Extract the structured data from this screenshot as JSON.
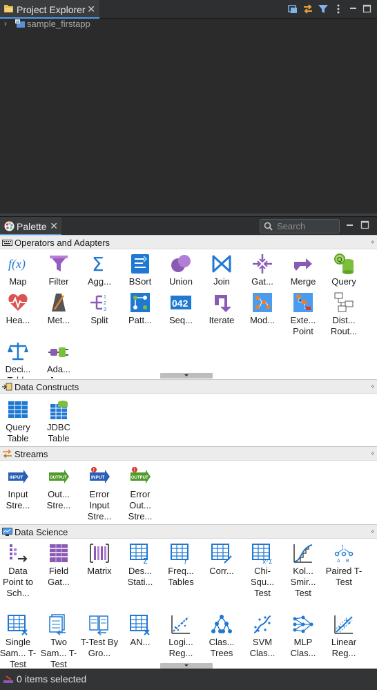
{
  "project_explorer": {
    "title": "Project Explorer",
    "tree": [
      {
        "label": "sample_firstapp",
        "expanded": false
      }
    ]
  },
  "palette": {
    "title": "Palette",
    "search_placeholder": "Search",
    "drawers": [
      {
        "title": "Operators and Adapters",
        "items": [
          {
            "label": "Map",
            "icon": "map-fx-icon"
          },
          {
            "label": "Filter",
            "icon": "funnel-icon"
          },
          {
            "label": "Agg...",
            "icon": "sigma-icon"
          },
          {
            "label": "BSort",
            "icon": "sort-icon"
          },
          {
            "label": "Union",
            "icon": "union-icon"
          },
          {
            "label": "Join",
            "icon": "bowtie-join-icon"
          },
          {
            "label": "Gat...",
            "icon": "gather-icon"
          },
          {
            "label": "Merge",
            "icon": "merge-arrow-icon"
          },
          {
            "label": "Query",
            "icon": "query-db-icon"
          },
          {
            "label": "Hea...",
            "icon": "heartbeat-icon"
          },
          {
            "label": "Met...",
            "icon": "metronome-icon"
          },
          {
            "label": "Split",
            "icon": "split-icon"
          },
          {
            "label": "Patt...",
            "icon": "pattern-icon"
          },
          {
            "label": "Seq...",
            "icon": "sequence-icon"
          },
          {
            "label": "Iterate",
            "icon": "iterate-icon"
          },
          {
            "label": "Mod...",
            "icon": "module-icon"
          },
          {
            "label": "Exte... Point",
            "icon": "extension-point-icon"
          },
          {
            "label": "Dist... Rout...",
            "icon": "distributed-router-icon"
          },
          {
            "label": "Deci... Table",
            "icon": "decision-scales-icon"
          },
          {
            "label": "Ada... Java",
            "icon": "java-adapter-plug-icon"
          }
        ]
      },
      {
        "title": "Data Constructs",
        "items": [
          {
            "label": "Query Table",
            "icon": "query-table-icon"
          },
          {
            "label": "JDBC Table",
            "icon": "jdbc-table-icon"
          }
        ]
      },
      {
        "title": "Streams",
        "items": [
          {
            "label": "Input Stre...",
            "icon": "input-stream-icon",
            "tag": "INPUT"
          },
          {
            "label": "Out... Stre...",
            "icon": "output-stream-icon",
            "tag": "OUTPUT"
          },
          {
            "label": "Error Input Stre...",
            "icon": "error-input-stream-icon",
            "tag": "INPUT"
          },
          {
            "label": "Error Out... Stre...",
            "icon": "error-output-stream-icon",
            "tag": "OUTPUT"
          }
        ]
      },
      {
        "title": "Data Science",
        "items": [
          {
            "label": "Data Point to Sch...",
            "icon": "data-point-schema-icon"
          },
          {
            "label": "Field Gat...",
            "icon": "field-gatherer-icon"
          },
          {
            "label": "Matrix",
            "icon": "matrix-icon"
          },
          {
            "label": "Des... Stati...",
            "icon": "descriptive-stats-icon"
          },
          {
            "label": "Freq... Tables",
            "icon": "frequency-table-icon"
          },
          {
            "label": "Corr...",
            "icon": "correlation-icon"
          },
          {
            "label": "Chi- Squ... Test",
            "icon": "chi-square-icon"
          },
          {
            "label": "Kol... Smir... Test",
            "icon": "kolmogorov-icon"
          },
          {
            "label": "Paired T-Test",
            "icon": "paired-ttest-icon"
          },
          {
            "label": "Single Sam... T-Test",
            "icon": "single-sample-ttest-icon"
          },
          {
            "label": "Two Sam... T-Test",
            "icon": "two-sample-ttest-icon"
          },
          {
            "label": "T-Test By Gro...",
            "icon": "ttest-by-group-icon"
          },
          {
            "label": "AN...",
            "icon": "anova-icon"
          },
          {
            "label": "Logi... Reg...",
            "icon": "logistic-regression-icon"
          },
          {
            "label": "Clas... Trees",
            "icon": "classification-trees-icon"
          },
          {
            "label": "SVM Clas...",
            "icon": "svm-icon"
          },
          {
            "label": "MLP Clas...",
            "icon": "mlp-icon"
          },
          {
            "label": "Linear Reg...",
            "icon": "linear-regression-icon"
          }
        ]
      }
    ]
  },
  "status_bar": {
    "text": "0 items selected"
  },
  "colors": {
    "accent_blue": "#1f78d1",
    "purple": "#8a5bb5",
    "orange": "#e9832b",
    "green": "#7dbf3a",
    "red": "#d93a2b",
    "dark_chrome": "#2b2b2b"
  }
}
